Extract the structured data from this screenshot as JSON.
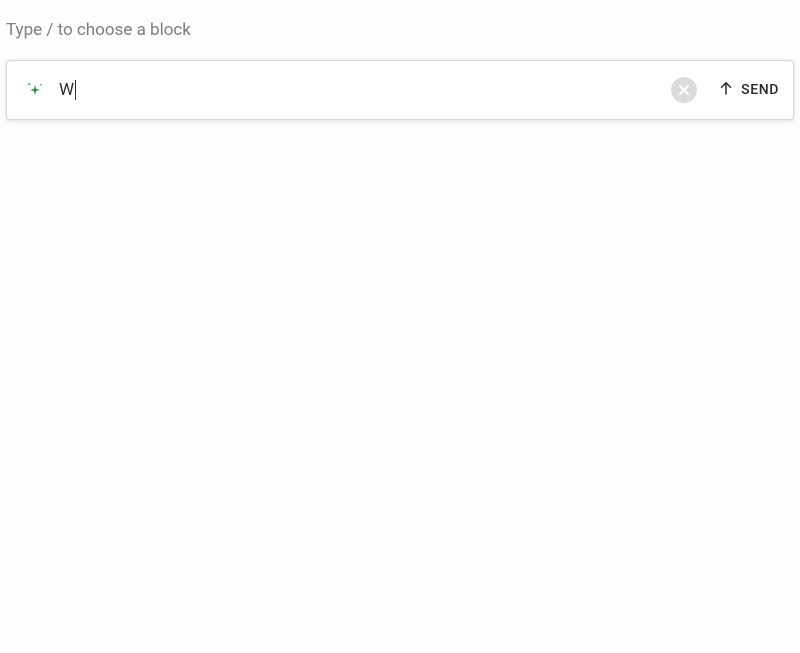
{
  "hint_text": "Type / to choose a block",
  "input": {
    "value": "W",
    "placeholder": ""
  },
  "send_label": "SEND",
  "colors": {
    "accent_green": "#1a8f3c",
    "muted_gray": "#dcdcdc",
    "text_muted": "#7d7d7d"
  }
}
